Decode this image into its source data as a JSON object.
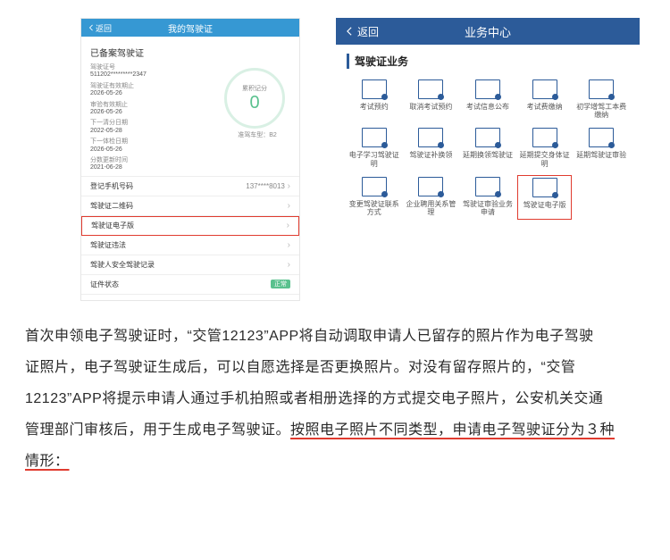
{
  "phone1": {
    "header_back": "返回",
    "header_title": "我的驾驶证",
    "section_title": "已备案驾驶证",
    "info": [
      {
        "label": "驾驶证号",
        "value": "511202*********2347"
      },
      {
        "label": "驾驶证有效期止",
        "value": "2026-05-26"
      },
      {
        "label": "审验有效期止",
        "value": "2026-05-26"
      },
      {
        "label": "下一清分日期",
        "value": "2022-05-28"
      },
      {
        "label": "下一体检日期",
        "value": "2026-05-26"
      },
      {
        "label": "分数更新时间",
        "value": "2021-06-28"
      }
    ],
    "ring_label": "累积记分",
    "ring_value": "0",
    "ring_caption": "准驾车型：B2",
    "list": [
      {
        "label": "登记手机号码",
        "right": "137****8013"
      },
      {
        "label": "驾驶证二维码"
      },
      {
        "label": "驾驶证电子版",
        "highlight": true
      },
      {
        "label": "驾驶证违法"
      },
      {
        "label": "驾驶人安全驾驶记录"
      },
      {
        "label": "证件状态",
        "status": "正常"
      }
    ]
  },
  "phone2": {
    "header_back": "返回",
    "header_title": "业务中心",
    "section_title": "驾驶证业务",
    "items": [
      {
        "label": "考试预约"
      },
      {
        "label": "取消考试预约"
      },
      {
        "label": "考试信息公布"
      },
      {
        "label": "考试费缴纳"
      },
      {
        "label": "初学增驾工本费缴纳"
      },
      {
        "label": "电子学习驾驶证明"
      },
      {
        "label": "驾驶证补换领"
      },
      {
        "label": "延期换领驾驶证"
      },
      {
        "label": "延期提交身体证明"
      },
      {
        "label": "延期驾驶证审验"
      },
      {
        "label": "变更驾驶证联系方式"
      },
      {
        "label": "企业聘用关系管理"
      },
      {
        "label": "驾驶证审验业务申请"
      },
      {
        "label": "驾驶证电子版",
        "highlight": true
      }
    ]
  },
  "article": {
    "p1a": "首次申领电子驾驶证时，“交管12123”APP将自动调取申请人已留存的照片作为电子驾驶",
    "p1b": "证照片，电子驾驶证生成后，可以自愿选择是否更换照片。对没有留存照片的，“交管",
    "p1c": "12123”APP将提示申请人通过手机拍照或者相册选择的方式提交电子照片，公安机关交通",
    "p1d_plain": "管理部门审核后，用于生成电子驾驶证。",
    "p1d_underlined": "按照电子照片不同类型，申请电子驾驶证分为３种",
    "p1e_underlined": "情形："
  }
}
